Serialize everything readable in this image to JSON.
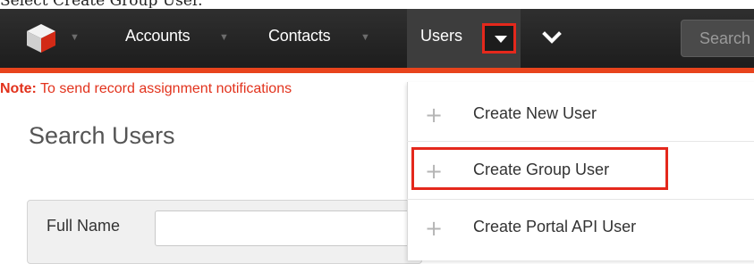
{
  "caption": "Select Create Group User.",
  "nav": {
    "items": [
      {
        "label": "Accounts"
      },
      {
        "label": "Contacts"
      },
      {
        "label": "Users"
      }
    ],
    "search_placeholder": "Search"
  },
  "note": {
    "prefix": "Note:",
    "text": " To send record assignment notifications"
  },
  "page_title": "Search Users",
  "search_form": {
    "full_name_label": "Full Name",
    "full_name_value": ""
  },
  "users_menu": {
    "items": [
      {
        "label": "Create New User",
        "icon": "plus-icon"
      },
      {
        "label": "Create Group User",
        "icon": "plus-icon",
        "highlighted": true
      },
      {
        "label": "Create Portal API User",
        "icon": "plus-icon"
      }
    ]
  },
  "colors": {
    "accent": "#e8441d",
    "highlight": "#e4281c",
    "navbar": "#2a2a2a",
    "note": "#e2321c"
  }
}
